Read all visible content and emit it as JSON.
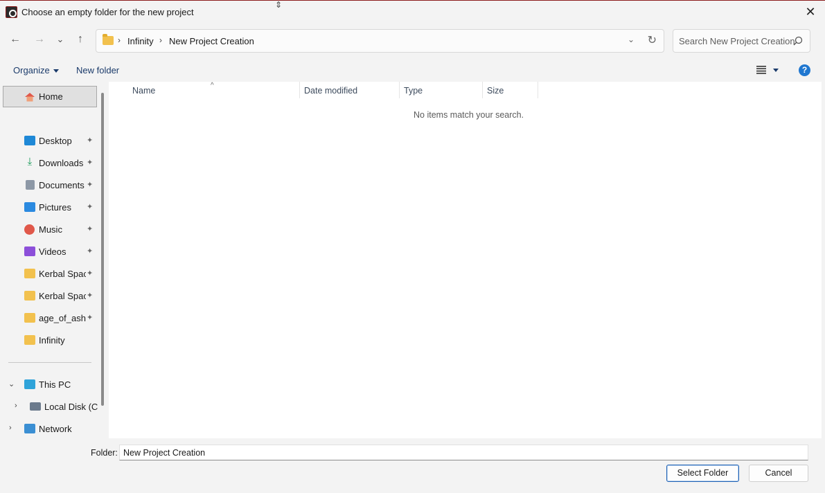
{
  "window": {
    "title": "Choose an empty folder for the new project",
    "close_glyph": "✕"
  },
  "nav": {
    "back_glyph": "←",
    "forward_glyph": "→",
    "recent_glyph": "⌄",
    "up_glyph": "↑",
    "breadcrumbs": [
      "Infinity",
      "New Project Creation"
    ],
    "breadcrumb_sep": "›",
    "dropdown_glyph": "⌄",
    "refresh_glyph": "↻",
    "search_placeholder": "Search New Project Creation"
  },
  "commands": {
    "organize_label": "Organize",
    "new_folder_label": "New folder",
    "help_glyph": "?"
  },
  "sidebar": {
    "home_label": "Home",
    "quick_access": [
      {
        "label": "Desktop",
        "icon": "desktop-icon",
        "pinned": true,
        "color": "#1e88d6"
      },
      {
        "label": "Downloads",
        "icon": "download-icon",
        "pinned": true,
        "color": "#1a9b5a"
      },
      {
        "label": "Documents",
        "icon": "documents-icon",
        "pinned": true,
        "color": "#8d98a6"
      },
      {
        "label": "Pictures",
        "icon": "pictures-icon",
        "pinned": true,
        "color": "#2b8ae0"
      },
      {
        "label": "Music",
        "icon": "music-icon",
        "pinned": true,
        "color": "#e0584a"
      },
      {
        "label": "Videos",
        "icon": "videos-icon",
        "pinned": true,
        "color": "#8c4fd9"
      },
      {
        "label": "Kerbal Space",
        "icon": "folder-icon",
        "pinned": true,
        "color": "#f2c14e"
      },
      {
        "label": "Kerbal Space",
        "icon": "folder-icon",
        "pinned": true,
        "color": "#f2c14e"
      },
      {
        "label": "age_of_ashes",
        "icon": "folder-icon",
        "pinned": true,
        "color": "#f2c14e"
      },
      {
        "label": "Infinity",
        "icon": "folder-icon",
        "pinned": false,
        "color": "#f2c14e"
      }
    ],
    "pin_glyph": "📌",
    "this_pc_label": "This PC",
    "local_disk_label": "Local Disk (C:)",
    "network_label": "Network"
  },
  "file_list": {
    "columns": [
      "Name",
      "Date modified",
      "Type",
      "Size"
    ],
    "sort_glyph": "^",
    "empty_message": "No items match your search."
  },
  "footer": {
    "folder_label": "Folder:",
    "folder_value": "New Project Creation",
    "select_button": "Select Folder",
    "cancel_button": "Cancel"
  },
  "colors": {
    "accent": "#1f62b5",
    "help": "#1f77d0",
    "titlebar_border": "#8b1a1a"
  }
}
